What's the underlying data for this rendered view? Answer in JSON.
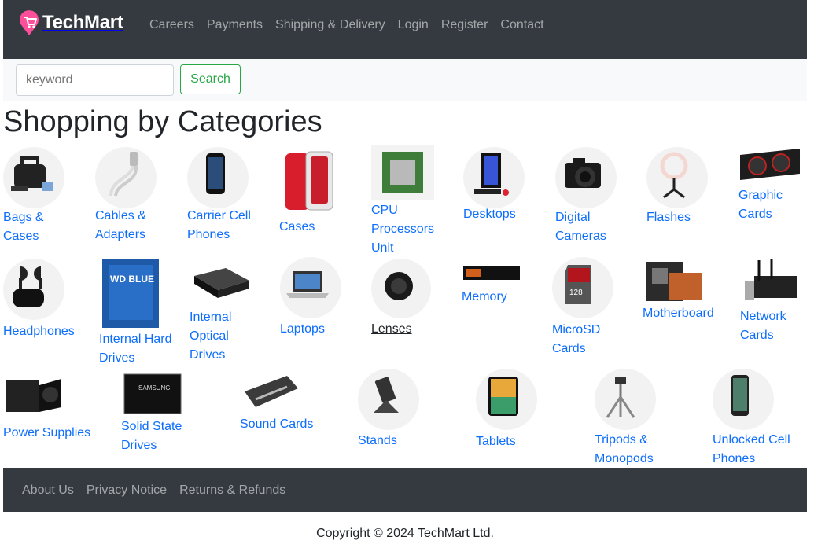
{
  "brand": {
    "name": "TechMart",
    "accent": "#ff4f9a"
  },
  "nav": [
    "Careers",
    "Payments",
    "Shipping & Delivery",
    "Login",
    "Register",
    "Contact"
  ],
  "search": {
    "placeholder": "keyword",
    "button": "Search"
  },
  "heading": "Shopping by Categories",
  "categories": [
    {
      "label": "Bags & Cases",
      "icon": "bag-icon"
    },
    {
      "label": "Cables & Adapters",
      "icon": "cable-icon"
    },
    {
      "label": "Carrier Cell Phones",
      "icon": "phone-icon"
    },
    {
      "label": "Cases",
      "icon": "phone-case-icon"
    },
    {
      "label": "CPU Processors Unit",
      "icon": "cpu-icon"
    },
    {
      "label": "Desktops",
      "icon": "desktop-icon"
    },
    {
      "label": "Digital Cameras",
      "icon": "camera-icon"
    },
    {
      "label": "Flashes",
      "icon": "ring-light-icon"
    },
    {
      "label": "Graphic Cards",
      "icon": "gpu-icon"
    },
    {
      "label": "Headphones",
      "icon": "earbuds-icon"
    },
    {
      "label": "Internal Hard Drives",
      "icon": "hdd-icon"
    },
    {
      "label": "Internal Optical Drives",
      "icon": "optical-drive-icon"
    },
    {
      "label": "Laptops",
      "icon": "laptop-icon"
    },
    {
      "label": "Lenses",
      "icon": "lens-icon"
    },
    {
      "label": "Memory",
      "icon": "ssd-stick-icon"
    },
    {
      "label": "MicroSD Cards",
      "icon": "sd-card-icon"
    },
    {
      "label": "Motherboard",
      "icon": "motherboard-icon"
    },
    {
      "label": "Network Cards",
      "icon": "network-card-icon"
    },
    {
      "label": "Power Supplies",
      "icon": "psu-icon"
    },
    {
      "label": "Solid State Drives",
      "icon": "ssd-icon"
    },
    {
      "label": "Sound Cards",
      "icon": "sound-card-icon"
    },
    {
      "label": "Stands",
      "icon": "stand-icon"
    },
    {
      "label": "Tablets",
      "icon": "tablet-icon"
    },
    {
      "label": "Tripods & Monopods",
      "icon": "tripod-icon"
    },
    {
      "label": "Unlocked Cell Phones",
      "icon": "smartphone-icon"
    }
  ],
  "footer": {
    "links": [
      "About Us",
      "Privacy Notice",
      "Returns & Refunds"
    ],
    "copyright": "Copyright © 2024 TechMart Ltd."
  }
}
